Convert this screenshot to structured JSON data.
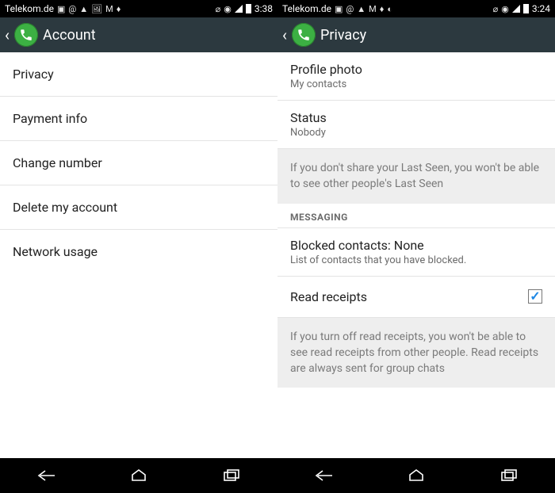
{
  "left": {
    "statusbar": {
      "carrier": "Telekom.de",
      "time": "3:38"
    },
    "appbar": {
      "title": "Account"
    },
    "items": [
      {
        "label": "Privacy"
      },
      {
        "label": "Payment info"
      },
      {
        "label": "Change number"
      },
      {
        "label": "Delete my account"
      },
      {
        "label": "Network usage"
      }
    ]
  },
  "right": {
    "statusbar": {
      "carrier": "Telekom.de",
      "time": "3:24"
    },
    "appbar": {
      "title": "Privacy"
    },
    "profile_photo": {
      "title": "Profile photo",
      "value": "My contacts"
    },
    "status": {
      "title": "Status",
      "value": "Nobody"
    },
    "last_seen_info": "If you don't share your Last Seen, you won't be able to see other people's Last Seen",
    "messaging_header": "MESSAGING",
    "blocked": {
      "title": "Blocked contacts: None",
      "subtitle": "List of contacts that you have blocked."
    },
    "read_receipts": {
      "title": "Read receipts",
      "checked": true
    },
    "read_receipts_info": "If you turn off read receipts, you won't be able to see read receipts from other people. Read receipts are always sent for group chats"
  },
  "icons": {
    "status_set": "▣ @ ⚠ 🖼 M 🔥 ⟳ ▯"
  }
}
